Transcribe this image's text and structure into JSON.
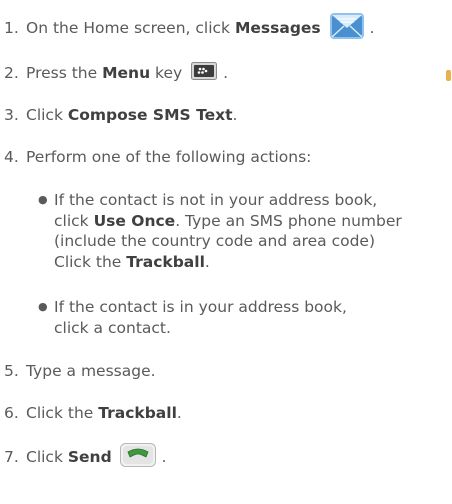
{
  "steps": [
    {
      "number": "1.",
      "prefix": "On the Home screen, click ",
      "bold": "Messages",
      "suffix": ".",
      "icon": "messages-envelope-icon"
    },
    {
      "number": "2.",
      "prefix": "Press the ",
      "bold": "Menu",
      "suffix": " key",
      "end": ".",
      "icon": "blackberry-menu-key-icon"
    },
    {
      "number": "3.",
      "prefix": "Click ",
      "bold": "Compose SMS Text",
      "suffix": "."
    },
    {
      "number": "4.",
      "text": "Perform one of the following actions:"
    },
    {
      "number": "5.",
      "text": "Type a message."
    },
    {
      "number": "6.",
      "prefix": "Click the ",
      "bold": "Trackball",
      "suffix": "."
    },
    {
      "number": "7.",
      "prefix": "Click ",
      "bold": "Send",
      "suffix": ".",
      "icon": "send-phone-icon"
    }
  ],
  "bullets": [
    {
      "line1": "If the contact is not in your address book,",
      "line2_prefix": "click ",
      "line2_bold": "Use Once",
      "line2_suffix": ". Type an SMS phone number",
      "line3": "(include the country code and area code)",
      "line4_prefix": "Click the ",
      "line4_bold": "Trackball",
      "line4_suffix": "."
    },
    {
      "line1": "If the contact is in your address book,",
      "line2": "click a contact."
    }
  ],
  "colors": {
    "text": "#5a5a5a",
    "bold_text": "#404040",
    "envelope_blue": "#4a8fd0",
    "send_green": "#3f9a3f"
  }
}
